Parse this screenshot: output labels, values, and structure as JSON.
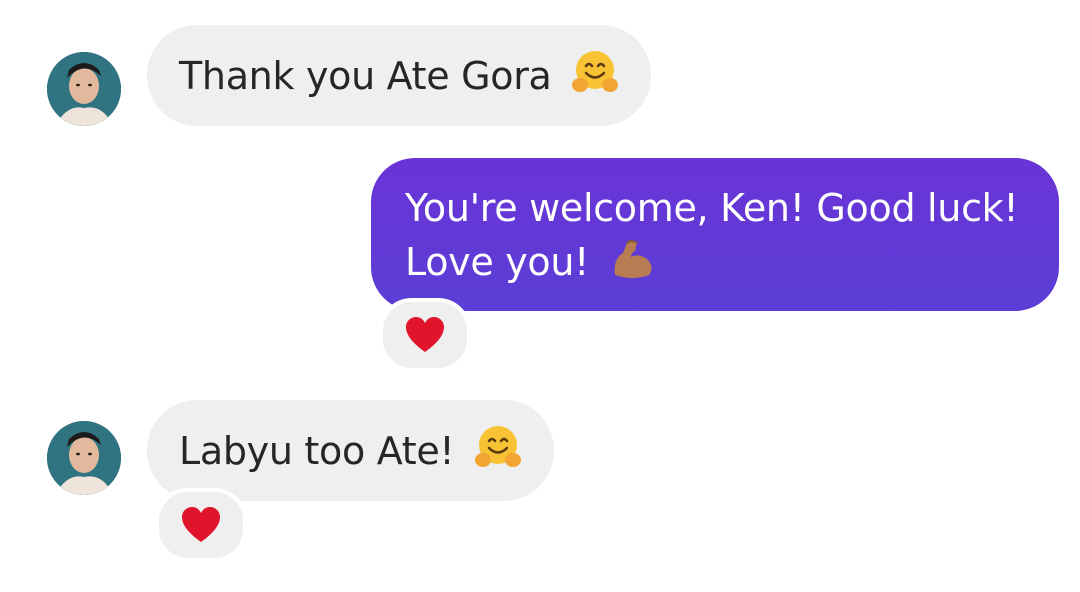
{
  "messages": [
    {
      "direction": "incoming",
      "avatar_icon": "profile-photo",
      "text": "Thank you Ate Gora",
      "emoji": "hugging-face-emoji"
    },
    {
      "direction": "outgoing",
      "line1": "You're welcome, Ken! Good luck!",
      "line2": "Love you!",
      "emoji": "flexed-biceps-emoji",
      "reaction": "heart-icon"
    },
    {
      "direction": "incoming",
      "avatar_icon": "profile-photo",
      "text": "Labyu too Ate!",
      "emoji": "hugging-face-emoji",
      "reaction": "heart-icon"
    }
  ],
  "colors": {
    "incoming_bubble": "#efefef",
    "outgoing_bubble": "#6236d6",
    "incoming_text": "#262626",
    "outgoing_text": "#ffffff",
    "heart": "#e0152b"
  }
}
